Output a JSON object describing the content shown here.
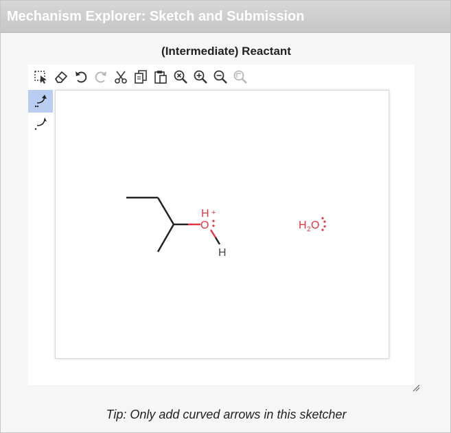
{
  "window": {
    "title": "Mechanism Explorer: Sketch and Submission"
  },
  "sketcher": {
    "heading": "(Intermediate) Reactant",
    "toolbar": [
      {
        "name": "select-tool",
        "icon": "dashed-select-icon",
        "enabled": true
      },
      {
        "name": "erase-tool",
        "icon": "eraser-icon",
        "enabled": true
      },
      {
        "name": "undo",
        "icon": "undo-icon",
        "enabled": true
      },
      {
        "name": "redo",
        "icon": "redo-icon",
        "enabled": false
      },
      {
        "name": "cut",
        "icon": "scissors-icon",
        "enabled": true
      },
      {
        "name": "copy",
        "icon": "copy-icon",
        "enabled": true
      },
      {
        "name": "paste",
        "icon": "paste-icon",
        "enabled": true
      },
      {
        "name": "zoom-reset",
        "icon": "zoom-reset-icon",
        "enabled": true
      },
      {
        "name": "zoom-in",
        "icon": "zoom-in-icon",
        "enabled": true
      },
      {
        "name": "zoom-out",
        "icon": "zoom-out-icon",
        "enabled": true
      },
      {
        "name": "zoom-fit",
        "icon": "zoom-fit-icon",
        "enabled": false
      }
    ],
    "left_tools": [
      {
        "name": "electron-pair-arrow",
        "icon": "double-headed-curved-arrow-icon",
        "active": true
      },
      {
        "name": "single-electron-arrow",
        "icon": "single-headed-curved-arrow-icon",
        "active": false
      }
    ],
    "molecules": {
      "oxonium": {
        "O": "O",
        "H1": "H",
        "H2": "H",
        "charge": "+"
      },
      "water": {
        "H": "H",
        "sub": "2",
        "O": "O"
      }
    },
    "colors": {
      "heteroatom": "#e8333f",
      "bond": "#222222",
      "active_tool": "#b9cdf0"
    }
  },
  "tip": "Tip: Only add curved arrows in this sketcher"
}
